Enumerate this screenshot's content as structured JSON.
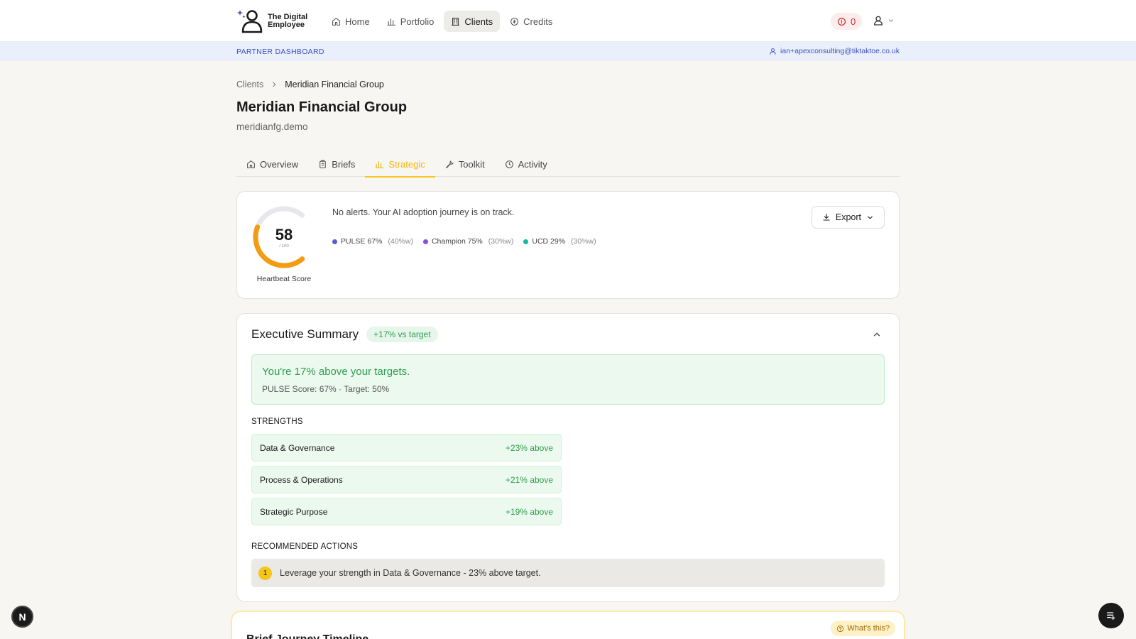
{
  "brand": {
    "name_line1": "The Digital",
    "name_line2": "Employee"
  },
  "nav": {
    "items": [
      {
        "label": "Home",
        "icon": "home-icon"
      },
      {
        "label": "Portfolio",
        "icon": "bar-chart-icon"
      },
      {
        "label": "Clients",
        "icon": "building-icon",
        "active": true
      },
      {
        "label": "Credits",
        "icon": "coin-icon"
      }
    ],
    "credits_count": "0"
  },
  "partner": {
    "label": "PARTNER DASHBOARD",
    "email": "ian+apexconsulting@tiktaktoe.co.uk"
  },
  "breadcrumb": {
    "parent": "Clients",
    "current": "Meridian Financial Group"
  },
  "page": {
    "title": "Meridian Financial Group",
    "subtitle": "meridianfg.demo"
  },
  "tabs": [
    {
      "label": "Overview",
      "icon": "home-icon"
    },
    {
      "label": "Briefs",
      "icon": "clipboard-icon"
    },
    {
      "label": "Strategic",
      "icon": "bar-chart-icon",
      "active": true
    },
    {
      "label": "Toolkit",
      "icon": "wrench-icon"
    },
    {
      "label": "Activity",
      "icon": "clock-icon"
    }
  ],
  "heartbeat": {
    "score": "58",
    "max": "/ 100",
    "score_fraction": 0.58,
    "label": "Heartbeat Score",
    "alert": "No alerts. Your AI adoption journey is on track.",
    "metrics": [
      {
        "label": "PULSE 67%",
        "weight": "(40%w)",
        "color": "#5b5bd6"
      },
      {
        "label": "Champion 75%",
        "weight": "(30%w)",
        "color": "#8a4fe0"
      },
      {
        "label": "UCD 29%",
        "weight": "(30%w)",
        "color": "#14b8a6"
      }
    ],
    "export_label": "Export",
    "gauge_color": "#f39c12",
    "gauge_track_color": "#e8e8ec"
  },
  "summary": {
    "title": "Executive Summary",
    "pill": "+17% vs target",
    "headline": "You're 17% above your targets.",
    "detail": "PULSE Score: 67% · Target: 50%",
    "strengths_label": "STRENGTHS",
    "strengths": [
      {
        "name": "Data & Governance",
        "delta": "+23% above"
      },
      {
        "name": "Process & Operations",
        "delta": "+21% above"
      },
      {
        "name": "Strategic Purpose",
        "delta": "+19% above"
      }
    ],
    "actions_label": "RECOMMENDED ACTIONS",
    "actions": [
      {
        "num": "1",
        "text": "Leverage your strength in Data & Governance - 23% above target."
      }
    ]
  },
  "timeline": {
    "title": "Brief Journey Timeline",
    "help": "What's this?"
  },
  "floating": {
    "n_badge": "N"
  }
}
